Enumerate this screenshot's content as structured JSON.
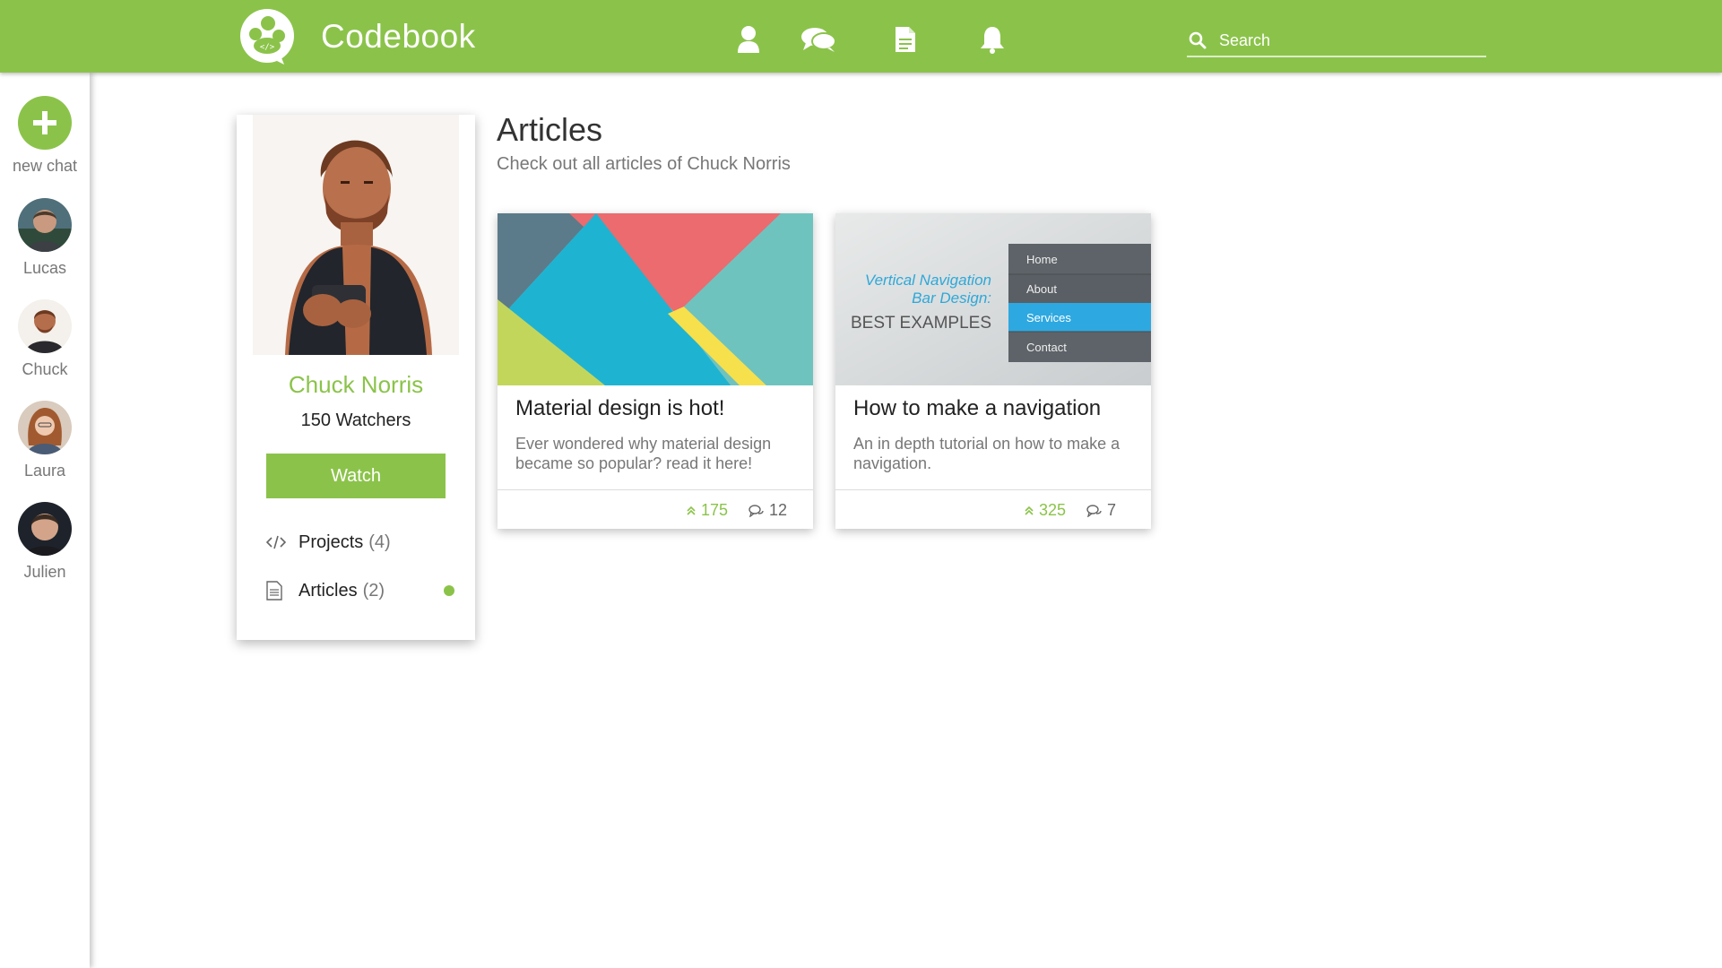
{
  "app": {
    "title": "Codebook",
    "brand_color": "#8bc34a"
  },
  "nav": {
    "icons": [
      "user-icon",
      "chat-icon",
      "document-icon",
      "bell-icon"
    ]
  },
  "search": {
    "placeholder": "Search"
  },
  "sidebar": {
    "new_chat_label": "new chat",
    "contacts": [
      {
        "name": "Lucas"
      },
      {
        "name": "Chuck"
      },
      {
        "name": "Laura"
      },
      {
        "name": "Julien"
      }
    ]
  },
  "profile": {
    "name": "Chuck Norris",
    "watchers": "150 Watchers",
    "watch_label": "Watch",
    "links": [
      {
        "label": "Projects",
        "count": "(4)",
        "icon": "code-icon"
      },
      {
        "label": "Articles",
        "count": "(2)",
        "icon": "document-icon"
      }
    ]
  },
  "articles": {
    "title": "Articles",
    "subtitle": "Check out all articles of Chuck Norris",
    "items": [
      {
        "title": "Material design is hot!",
        "description": "Ever wondered why material design became so popular? read it here!",
        "upvotes": "175",
        "comments": "12"
      },
      {
        "title": "How to make a navigation",
        "description": "An in depth tutorial on how to make a navigation.",
        "upvotes": "325",
        "comments": "7",
        "image_text": {
          "line1": "Vertical Navigation",
          "line2": "Bar Design:",
          "line3": "BEST EXAMPLES",
          "menu": [
            "Home",
            "About",
            "Services",
            "Contact"
          ]
        }
      }
    ]
  }
}
